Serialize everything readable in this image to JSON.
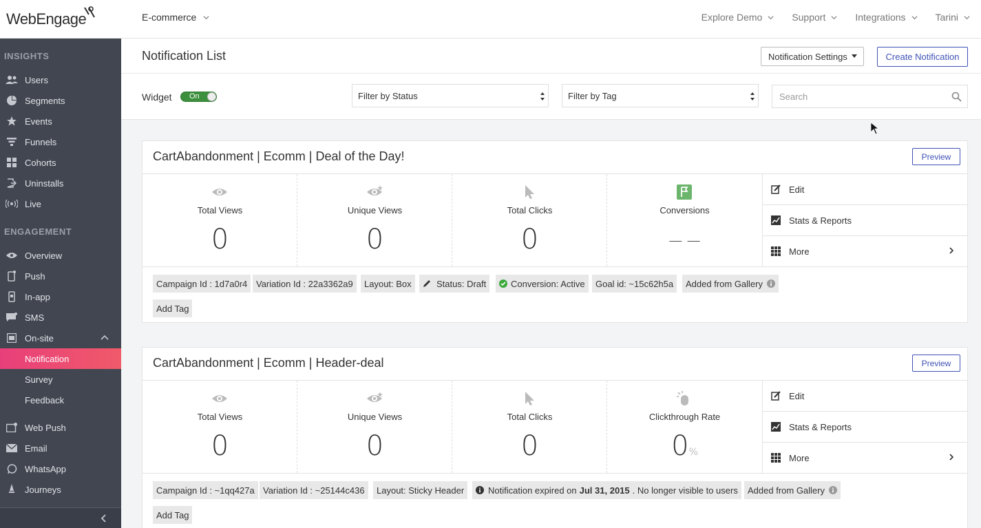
{
  "brand": {
    "logo": "WebEngage"
  },
  "header": {
    "project": "E-commerce",
    "nav": [
      {
        "label": "Explore Demo"
      },
      {
        "label": "Support"
      },
      {
        "label": "Integrations"
      },
      {
        "label": "Tarini"
      }
    ]
  },
  "sidebar": {
    "insights_title": "INSIGHTS",
    "insights": [
      {
        "label": "Users",
        "icon": "users-icon"
      },
      {
        "label": "Segments",
        "icon": "pie-icon"
      },
      {
        "label": "Events",
        "icon": "star-icon"
      },
      {
        "label": "Funnels",
        "icon": "funnel-icon"
      },
      {
        "label": "Cohorts",
        "icon": "grid-icon"
      },
      {
        "label": "Uninstalls",
        "icon": "exit-icon"
      },
      {
        "label": "Live",
        "icon": "broadcast-icon"
      }
    ],
    "engagement_title": "ENGAGEMENT",
    "engagement": [
      {
        "label": "Overview",
        "icon": "eye-icon"
      },
      {
        "label": "Push",
        "icon": "push-icon"
      },
      {
        "label": "In-app",
        "icon": "phone-icon"
      },
      {
        "label": "SMS",
        "icon": "sms-icon"
      },
      {
        "label": "On-site",
        "icon": "onsite-icon"
      }
    ],
    "onsite_sub": [
      {
        "label": "Notification",
        "active": true
      },
      {
        "label": "Survey"
      },
      {
        "label": "Feedback"
      }
    ],
    "more": [
      {
        "label": "Web Push",
        "icon": "webpush-icon"
      },
      {
        "label": "Email",
        "icon": "email-icon"
      },
      {
        "label": "WhatsApp",
        "icon": "whatsapp-icon"
      },
      {
        "label": "Journeys",
        "icon": "journey-icon"
      }
    ],
    "active_color": "#ec4a72"
  },
  "page": {
    "title": "Notification List",
    "settings_label": "Notification Settings",
    "create_label": "Create Notification",
    "widget_label": "Widget",
    "toggle_label": "On",
    "filter_status": "Filter by Status",
    "filter_tag": "Filter by Tag",
    "search_placeholder": "Search"
  },
  "cards": [
    {
      "title": "CartAbandonment | Ecomm | Deal of the Day!",
      "preview": "Preview",
      "metrics": [
        {
          "label": "Total Views",
          "value": "0"
        },
        {
          "label": "Unique Views",
          "value": "0"
        },
        {
          "label": "Total Clicks",
          "value": "0"
        },
        {
          "label": "Conversions",
          "value": "— —"
        }
      ],
      "actions": [
        "Edit",
        "Stats & Reports",
        "More"
      ],
      "tags": {
        "campaign": "Campaign Id : 1d7a0r4",
        "variation": "Variation Id : 22a3362a9",
        "layout": "Layout: Box",
        "status": "Status: Draft",
        "conversion": "Conversion: Active",
        "goal": "Goal id:  ~15c62h5a",
        "gallery": "Added from Gallery",
        "add_tag": "Add Tag"
      }
    },
    {
      "title": "CartAbandonment | Ecomm | Header-deal",
      "preview": "Preview",
      "metrics": [
        {
          "label": "Total Views",
          "value": "0"
        },
        {
          "label": "Unique Views",
          "value": "0"
        },
        {
          "label": "Total Clicks",
          "value": "0"
        },
        {
          "label": "Clickthrough Rate",
          "value": "0",
          "unit": "%"
        }
      ],
      "actions": [
        "Edit",
        "Stats & Reports",
        "More"
      ],
      "tags": {
        "campaign": "Campaign Id : ~1qq427a",
        "variation": "Variation Id : ~25144c436",
        "layout": "Layout: Sticky Header",
        "expired_pre": "Notification expired on",
        "expired_date": "Jul 31, 2015",
        "expired_post": ". No longer visible to users",
        "gallery": "Added from Gallery",
        "add_tag": "Add Tag"
      }
    }
  ]
}
